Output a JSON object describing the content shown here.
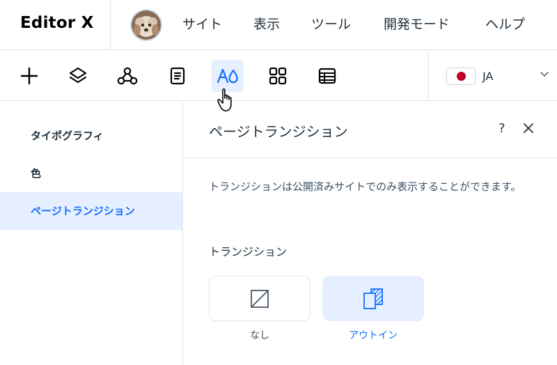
{
  "app": {
    "logo_text": "Editor X"
  },
  "menu": [
    {
      "label": "サイト"
    },
    {
      "label": "表示"
    },
    {
      "label": "ツール"
    },
    {
      "label": "開発モード"
    },
    {
      "label": "ヘルプ"
    }
  ],
  "toolbar": {
    "tools": [
      {
        "icon": "plus-icon"
      },
      {
        "icon": "layers-icon"
      },
      {
        "icon": "connect-icon"
      },
      {
        "icon": "pages-icon"
      },
      {
        "icon": "theme-icon",
        "active": true
      },
      {
        "icon": "apps-grid-icon"
      },
      {
        "icon": "table-icon"
      }
    ],
    "language": {
      "code": "JA",
      "flag": "japan-flag-icon"
    }
  },
  "sidebar": {
    "items": [
      {
        "label": "タイポグラフィ"
      },
      {
        "label": "色"
      },
      {
        "label": "ページトランジション",
        "selected": true
      }
    ]
  },
  "panel": {
    "title": "ページトランジション",
    "help": "?",
    "info": "トランジションは公開済みサイトでのみ表示することができます。",
    "section_label": "トランジション",
    "options": [
      {
        "label": "なし",
        "icon": "none-icon"
      },
      {
        "label": "アウトイン",
        "icon": "out-in-icon",
        "selected": true
      }
    ]
  },
  "colors": {
    "accent": "#116dff",
    "selected_bg": "#e6efff",
    "text": "#20303c",
    "border": "#dfe5eb"
  }
}
